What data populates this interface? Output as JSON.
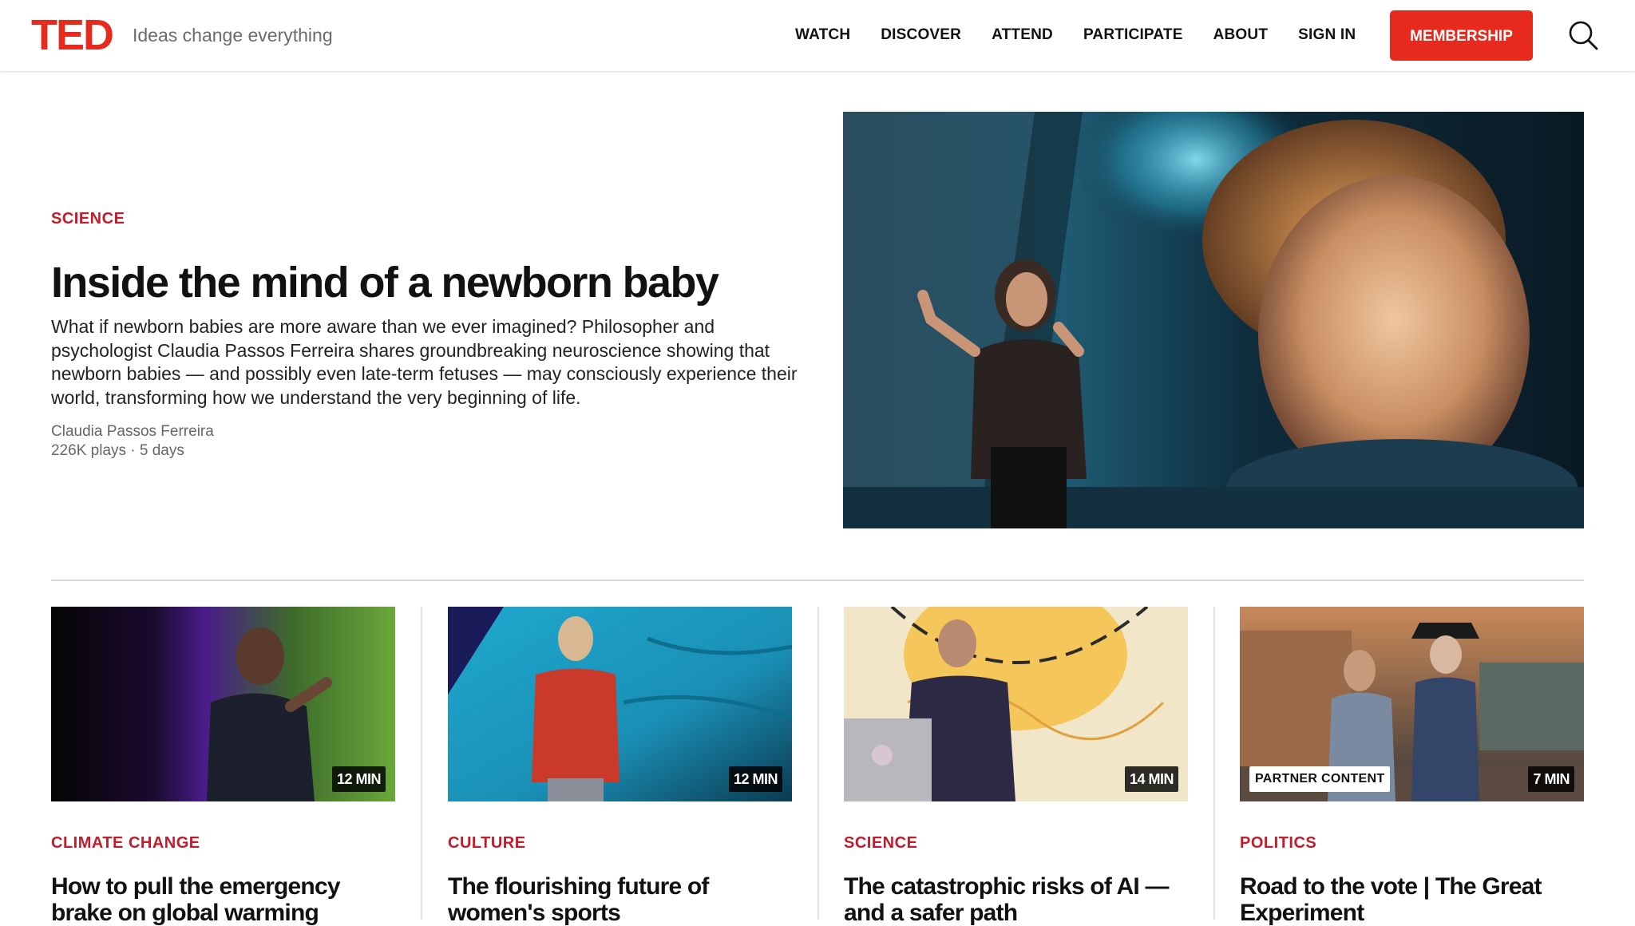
{
  "header": {
    "logo_text": "TED",
    "tagline": "Ideas change everything",
    "nav": [
      "WATCH",
      "DISCOVER",
      "ATTEND",
      "PARTICIPATE",
      "ABOUT",
      "SIGN IN"
    ],
    "membership_label": "MEMBERSHIP",
    "search_icon": "search-icon",
    "brand_color": "#e62b1e"
  },
  "hero": {
    "category": "SCIENCE",
    "title": "Inside the mind of a newborn baby",
    "description": "What if newborn babies are more aware than we ever imagined? Philosopher and psychologist Claudia Passos Ferreira shares groundbreaking neuroscience showing that newborn babies — and possibly even late-term fetuses — may consciously experience their world, transforming how we understand the very beginning of life.",
    "speaker": "Claudia Passos Ferreira",
    "meta": "226K plays · 5 days"
  },
  "cards": [
    {
      "category": "CLIMATE CHANGE",
      "title": "How to pull the emergency brake on global warming",
      "duration": "12 MIN",
      "badge": ""
    },
    {
      "category": "CULTURE",
      "title": "The flourishing future of women's sports",
      "duration": "12 MIN",
      "badge": ""
    },
    {
      "category": "SCIENCE",
      "title": "The catastrophic risks of AI — and a safer path",
      "duration": "14 MIN",
      "badge": ""
    },
    {
      "category": "POLITICS",
      "title": "Road to the vote | The Great Experiment",
      "duration": "7 MIN",
      "badge": "PARTNER CONTENT"
    }
  ],
  "category_color": "#c11c2b"
}
